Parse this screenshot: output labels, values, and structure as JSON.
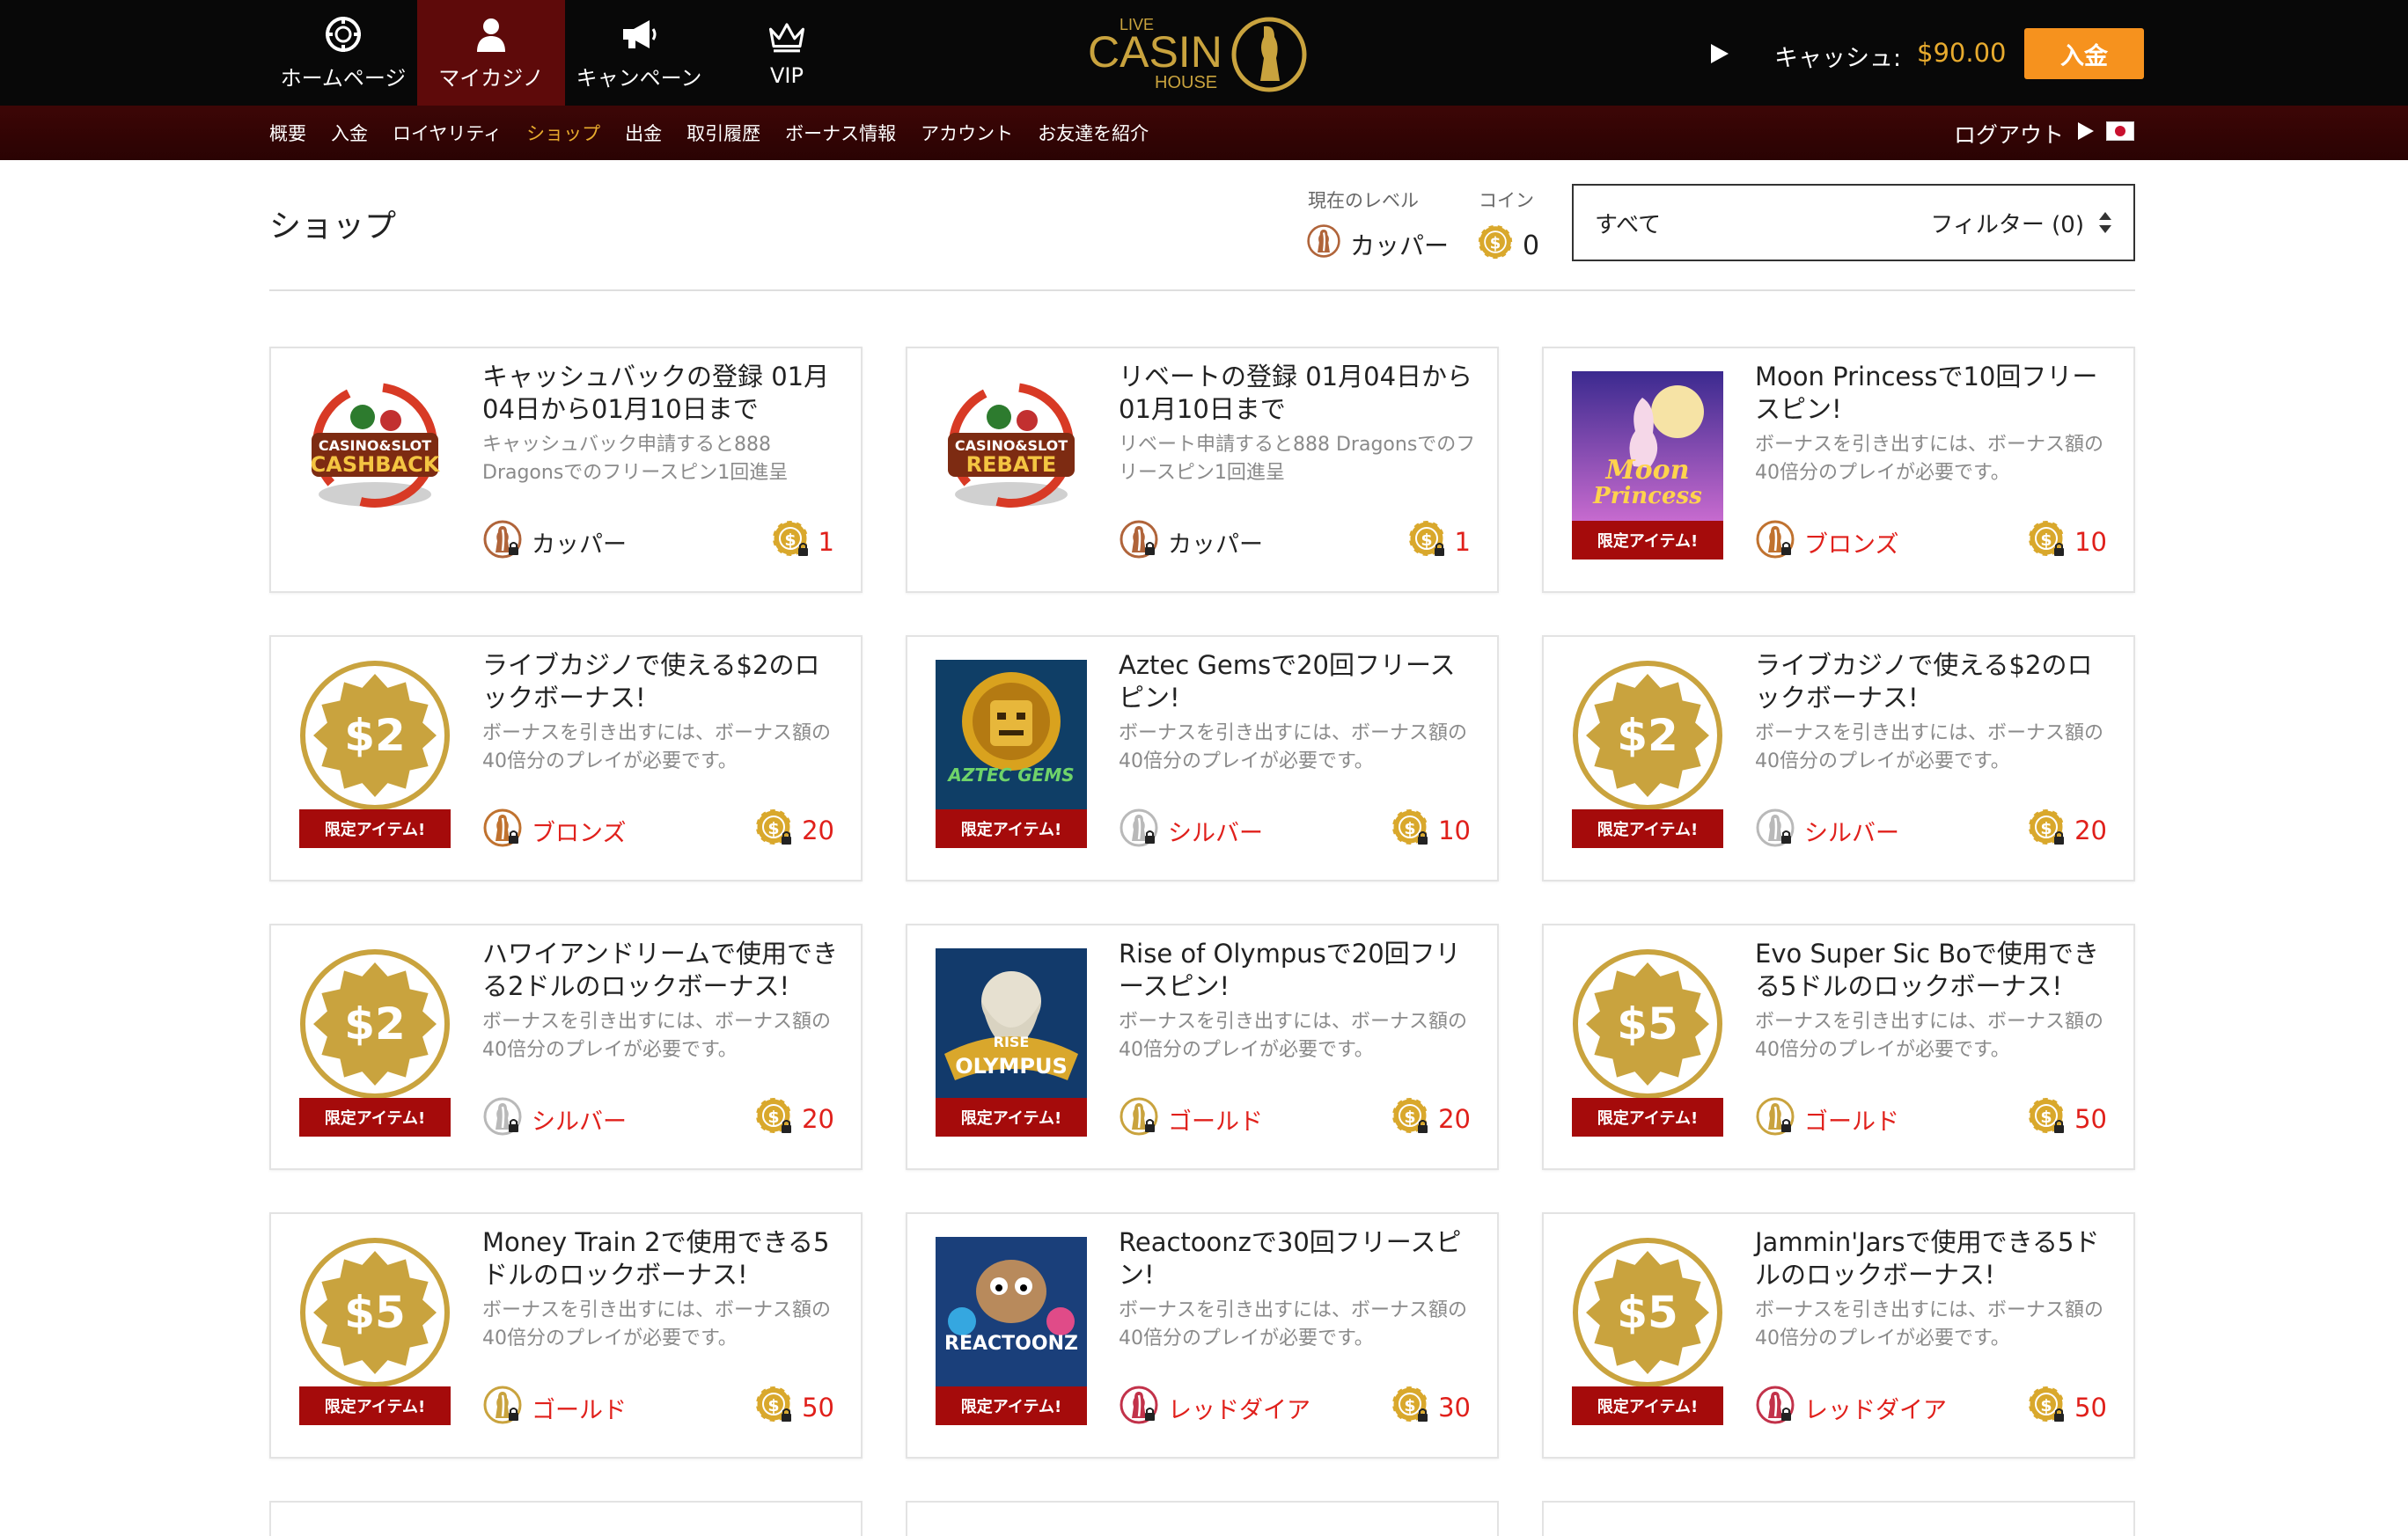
{
  "topnav": {
    "items": [
      {
        "label": "ホームページ",
        "icon": "chip-icon",
        "active": false
      },
      {
        "label": "マイカジノ",
        "icon": "user-icon",
        "active": true
      },
      {
        "label": "キャンペーン",
        "icon": "megaphone-icon",
        "active": false
      },
      {
        "label": "VIP",
        "icon": "crown-icon",
        "active": false
      }
    ]
  },
  "logo": {
    "live": "LIVE",
    "casino": "CASIN",
    "house": "HOUSE"
  },
  "header": {
    "cash_label": "キャッシュ:",
    "cash_value": "$90.00",
    "deposit_label": "入金"
  },
  "subnav": {
    "items": [
      {
        "label": "概要",
        "active": false
      },
      {
        "label": "入金",
        "active": false
      },
      {
        "label": "ロイヤリティ",
        "active": false
      },
      {
        "label": "ショップ",
        "active": true
      },
      {
        "label": "出金",
        "active": false
      },
      {
        "label": "取引履歴",
        "active": false
      },
      {
        "label": "ボーナス情報",
        "active": false
      },
      {
        "label": "アカウント",
        "active": false
      },
      {
        "label": "お友達を紹介",
        "active": false
      }
    ],
    "logout_label": "ログアウト"
  },
  "shop": {
    "title": "ショップ",
    "level_label": "現在のレベル",
    "level_value": "カッパー",
    "coin_label": "コイン",
    "coin_value": "0",
    "filter_all": "すべて",
    "filter_label": "フィルター (0)"
  },
  "colors": {
    "copper": "#b0643a",
    "bronze": "#c0722f",
    "silver": "#b9b9b9",
    "gold": "#c9a33e",
    "red_diamond": "#c2324a",
    "accent_red": "#e0201b",
    "limited_bg": "#a50b0b",
    "deposit_orange": "#f6921e"
  },
  "cards": [
    {
      "title": "キャッシュバックの登録 01月04日から01月10日まで",
      "desc": "キャッシュバック申請すると888 Dragonsでのフリースピン1回進呈",
      "thumb": "cashback-badge",
      "thumb_text": [
        "CASINO&SLOT",
        "CASHBACK"
      ],
      "limited": "",
      "tier": "カッパー",
      "tier_key": "copper",
      "cost": "1"
    },
    {
      "title": "リベートの登録 01月04日から01月10日まで",
      "desc": "リベート申請すると888 Dragonsでのフリースピン1回進呈",
      "thumb": "rebate-badge",
      "thumb_text": [
        "CASINO&SLOT",
        "REBATE"
      ],
      "limited": "",
      "tier": "カッパー",
      "tier_key": "copper",
      "cost": "1"
    },
    {
      "title": "Moon Princessで10回フリースピン!",
      "desc": "ボーナスを引き出すには、ボーナス額の40倍分のプレイが必要です。",
      "thumb": "game-moon-princess",
      "thumb_text": [
        "Moon",
        "Princess"
      ],
      "limited": "限定アイテム!",
      "tier": "ブロンズ",
      "tier_key": "bronze",
      "cost": "10"
    },
    {
      "title": "ライブカジノで使える$2のロックボーナス!",
      "desc": "ボーナスを引き出すには、ボーナス額の40倍分のプレイが必要です。",
      "thumb": "dollar-badge",
      "thumb_text": [
        "$2"
      ],
      "limited": "限定アイテム!",
      "tier": "ブロンズ",
      "tier_key": "bronze",
      "cost": "20"
    },
    {
      "title": "Aztec Gemsで20回フリースピン!",
      "desc": "ボーナスを引き出すには、ボーナス額の40倍分のプレイが必要です。",
      "thumb": "game-aztec-gems",
      "thumb_text": [
        "AZTEC GEMS"
      ],
      "limited": "限定アイテム!",
      "tier": "シルバー",
      "tier_key": "silver",
      "cost": "10"
    },
    {
      "title": "ライブカジノで使える$2のロックボーナス!",
      "desc": "ボーナスを引き出すには、ボーナス額の40倍分のプレイが必要です。",
      "thumb": "dollar-badge",
      "thumb_text": [
        "$2"
      ],
      "limited": "限定アイテム!",
      "tier": "シルバー",
      "tier_key": "silver",
      "cost": "20"
    },
    {
      "title": "ハワイアンドリームで使用できる2ドルのロックボーナス!",
      "desc": "ボーナスを引き出すには、ボーナス額の40倍分のプレイが必要です。",
      "thumb": "dollar-badge",
      "thumb_text": [
        "$2"
      ],
      "limited": "限定アイテム!",
      "tier": "シルバー",
      "tier_key": "silver",
      "cost": "20"
    },
    {
      "title": "Rise of Olympusで20回フリースピン!",
      "desc": "ボーナスを引き出すには、ボーナス額の40倍分のプレイが必要です。",
      "thumb": "game-rise-of-olympus",
      "thumb_text": [
        "RISE",
        "OLYMPUS"
      ],
      "limited": "限定アイテム!",
      "tier": "ゴールド",
      "tier_key": "gold",
      "cost": "20"
    },
    {
      "title": "Evo Super Sic Boで使用できる5ドルのロックボーナス!",
      "desc": "ボーナスを引き出すには、ボーナス額の40倍分のプレイが必要です。",
      "thumb": "dollar-badge",
      "thumb_text": [
        "$5"
      ],
      "limited": "限定アイテム!",
      "tier": "ゴールド",
      "tier_key": "gold",
      "cost": "50"
    },
    {
      "title": "Money Train 2で使用できる5ドルのロックボーナス!",
      "desc": "ボーナスを引き出すには、ボーナス額の40倍分のプレイが必要です。",
      "thumb": "dollar-badge",
      "thumb_text": [
        "$5"
      ],
      "limited": "限定アイテム!",
      "tier": "ゴールド",
      "tier_key": "gold",
      "cost": "50"
    },
    {
      "title": "Reactoonzで30回フリースピン!",
      "desc": "ボーナスを引き出すには、ボーナス額の40倍分のプレイが必要です。",
      "thumb": "game-reactoonz",
      "thumb_text": [
        "REACTOONZ"
      ],
      "limited": "限定アイテム!",
      "tier": "レッドダイア",
      "tier_key": "red_diamond",
      "cost": "30"
    },
    {
      "title": "Jammin'Jarsで使用できる5ドルのロックボーナス!",
      "desc": "ボーナスを引き出すには、ボーナス額の40倍分のプレイが必要です。",
      "thumb": "dollar-badge",
      "thumb_text": [
        "$5"
      ],
      "limited": "限定アイテム!",
      "tier": "レッドダイア",
      "tier_key": "red_diamond",
      "cost": "50"
    }
  ]
}
